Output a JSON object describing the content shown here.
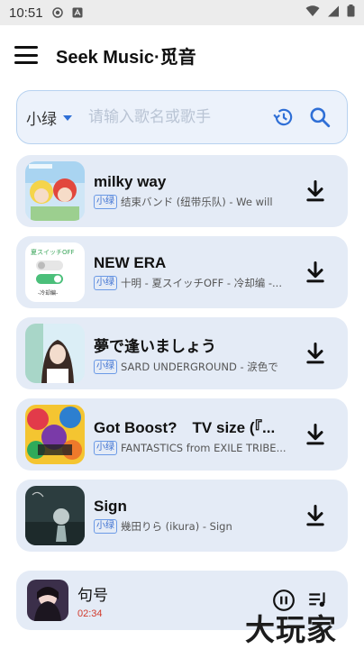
{
  "status_bar": {
    "time": "10:51"
  },
  "app": {
    "title": "Seek Music·觅音"
  },
  "search": {
    "source": "小绿",
    "placeholder": "请输入歌名或歌手"
  },
  "songs": [
    {
      "title": "milky way",
      "tag": "小绿",
      "artist": "结束バンド (纽带乐队) - We will"
    },
    {
      "title": "NEW ERA",
      "tag": "小绿",
      "artist": "十明 - 夏スイッチOFF - 冷却编 -..."
    },
    {
      "title": "夢で逢いましょう",
      "tag": "小绿",
      "artist": "SARD UNDERGROUND - 涙色で"
    },
    {
      "title": "Got Boost?　TV size (『...",
      "tag": "小绿",
      "artist": "FANTASTICS from EXILE TRIBE..."
    },
    {
      "title": "Sign",
      "tag": "小绿",
      "artist": "幾田りら (ikura) - Sign"
    }
  ],
  "cover_texts": {
    "song2_line1": "夏スイッチOFF",
    "song2_line2": "-冷却編-"
  },
  "player": {
    "title": "句号",
    "time": "02:34"
  },
  "watermark": "大玩家",
  "colors": {
    "accent": "#2f6fd6",
    "card_bg": "#e4ebf6",
    "time_red": "#d23a2b"
  }
}
